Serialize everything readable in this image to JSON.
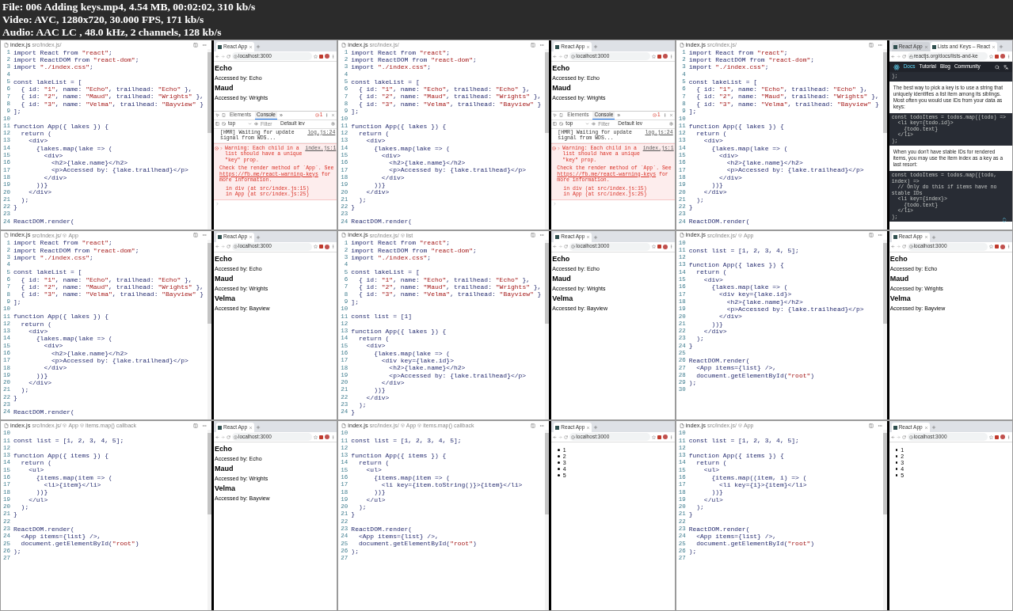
{
  "header": [
    "File: 006 Adding keys.mp4, 4.54 MB, 00:02:02, 310 kb/s",
    "Video: AVC, 1280x720, 30.000 FPS, 171 kb/s",
    "Audio: AAC LC , 48.0 kHz, 2 channels, 128 kb/s"
  ],
  "frames": [
    {
      "editor": {
        "file": "index.js",
        "breadcrumb": [
          "src/index.js/"
        ],
        "lines": [
          {
            "n": "1",
            "code": "import React from \"react\";"
          },
          {
            "n": "2",
            "code": "import ReactDOM from \"react-dom\";"
          },
          {
            "n": "3",
            "code": "import \"./index.css\";"
          },
          {
            "n": "4"
          },
          {
            "n": "5",
            "code": "const lakeList = ["
          },
          {
            "n": "6",
            "code": "  { id: \"1\", name: \"Echo\", trailhead: \"Echo\" },"
          },
          {
            "n": "7",
            "code": "  { id: \"2\", name: \"Maud\", trailhead: \"Wrights\" },"
          },
          {
            "n": "8",
            "code": "  { id: \"3\", name: \"Velma\", trailhead: \"Bayview\" }"
          },
          {
            "n": "9",
            "code": "];"
          },
          {
            "n": "10"
          },
          {
            "n": "11",
            "code": "function App({ lakes }) {"
          },
          {
            "n": "12",
            "code": "  return ("
          },
          {
            "n": "13",
            "code": "    <div>"
          },
          {
            "n": "14",
            "code": "      {lakes.map(lake => ("
          },
          {
            "n": "15",
            "code": "        <div>"
          },
          {
            "n": "16",
            "code": "          <h2>{lake.name}</h2>"
          },
          {
            "n": "17",
            "code": "          <p>Accessed by: {lake.trailhead}</p>"
          },
          {
            "n": "18",
            "code": "        </div>"
          },
          {
            "n": "19",
            "code": "      ))}"
          },
          {
            "n": "20",
            "code": "    </div>"
          },
          {
            "n": "21",
            "code": "  );"
          },
          {
            "n": "22",
            "code": "}"
          },
          {
            "n": "23"
          },
          {
            "n": "24",
            "code": "ReactDOM.render("
          }
        ]
      },
      "browser": {
        "tabs": [
          {
            "title": "React App",
            "selected": true
          }
        ],
        "url": "localhost:3000",
        "secure": false,
        "page": {
          "kind": "lakes",
          "items": [
            {
              "kind": "heading",
              "text": "Echo"
            },
            {
              "kind": "para",
              "text": "Accessed by: Echo"
            },
            {
              "kind": "heading",
              "text": "Maud"
            },
            {
              "kind": "para",
              "text": "Accessed by: Wrights"
            }
          ]
        },
        "devtools": {
          "tabs": [
            {
              "label": "Elements",
              "selected": false
            },
            {
              "label": "Console",
              "selected": true
            }
          ],
          "more": "»",
          "errors": "1",
          "context": "top",
          "filter_placeholder": "Filter",
          "levels": "Default lev",
          "messages": [
            {
              "kind": "log",
              "text": "[HMR] Waiting for update signal from WDS...",
              "source": "log.js:24"
            },
            {
              "kind": "warning",
              "summary": "Warning: Each child in a list should have a unique \"key\" prop.",
              "source": "index.js:1",
              "detail_before": "Check the render method of `App`. See ",
              "link": "https://fb.me/react-warning-keys",
              "detail_after": " for more information.",
              "stack": [
                "in div (at src/index.js:15)",
                "in App (at src/index.js:25)"
              ]
            }
          ]
        }
      }
    },
    {
      "editor": {
        "file": "index.js",
        "breadcrumb": [
          "src/index.js/"
        ],
        "lines": [
          {
            "n": "1",
            "code": "import React from \"react\";"
          },
          {
            "n": "2",
            "code": "import ReactDOM from \"react-dom\";"
          },
          {
            "n": "3",
            "code": "import \"./index.css\";"
          },
          {
            "n": "4"
          },
          {
            "n": "5",
            "code": "const lakeList = ["
          },
          {
            "n": "6",
            "code": "  { id: \"1\", name: \"Echo\", trailhead: \"Echo\" },"
          },
          {
            "n": "7",
            "code": "  { id: \"2\", name: \"Maud\", trailhead: \"Wrights\" },"
          },
          {
            "n": "8",
            "code": "  { id: \"3\", name: \"Velma\", trailhead: \"Bayview\" }"
          },
          {
            "n": "9",
            "code": "];"
          },
          {
            "n": "10"
          },
          {
            "n": "11",
            "code": "function App({ lakes }) {"
          },
          {
            "n": "12",
            "code": "  return ("
          },
          {
            "n": "13",
            "code": "    <div>"
          },
          {
            "n": "14",
            "code": "      {lakes.map(lake => ("
          },
          {
            "n": "15",
            "code": "        <div>"
          },
          {
            "n": "16",
            "code": "          <h2>{lake.name}</h2>"
          },
          {
            "n": "17",
            "code": "          <p>Accessed by: {lake.trailhead}</p>"
          },
          {
            "n": "18",
            "code": "        </div>"
          },
          {
            "n": "19",
            "code": "      ))}"
          },
          {
            "n": "20",
            "code": "    </div>"
          },
          {
            "n": "21",
            "code": "  );"
          },
          {
            "n": "22",
            "code": "}"
          },
          {
            "n": "23"
          },
          {
            "n": "24",
            "code": "ReactDOM.render("
          }
        ]
      },
      "browser": {
        "tabs": [
          {
            "title": "React App",
            "selected": true
          }
        ],
        "url": "localhost:3000",
        "secure": false,
        "page": {
          "kind": "lakes",
          "items": [
            {
              "kind": "heading",
              "text": "Echo"
            },
            {
              "kind": "para",
              "text": "Accessed by: Echo"
            },
            {
              "kind": "heading",
              "text": "Maud"
            },
            {
              "kind": "para",
              "text": "Accessed by: Wrights"
            }
          ]
        },
        "devtools": {
          "tabs": [
            {
              "label": "Elements",
              "selected": false
            },
            {
              "label": "Console",
              "selected": true
            }
          ],
          "more": "»",
          "errors": "1",
          "context": "top",
          "filter_placeholder": "Filter",
          "levels": "Default lev",
          "messages": [
            {
              "kind": "log",
              "text": "[HMR] Waiting for update signal from WDS...",
              "source": "log.js:24"
            },
            {
              "kind": "warning",
              "summary": "Warning: Each child in a list should have a unique \"key\" prop.",
              "source": "index.js:1",
              "detail_before": "Check the render method of `App`. See ",
              "link": "https://fb.me/react-warning-keys",
              "detail_after": " for more information.",
              "stack": [
                "in div (at src/index.js:15)",
                "in App (at src/index.js:25)"
              ]
            }
          ]
        }
      }
    },
    {
      "editor": {
        "file": "index.js",
        "breadcrumb": [
          "src/index.js/"
        ],
        "lines": [
          {
            "n": "1",
            "code": "import React from \"react\";"
          },
          {
            "n": "2",
            "code": "import ReactDOM from \"react-dom\";"
          },
          {
            "n": "3",
            "code": "import \"./index.css\";"
          },
          {
            "n": "4"
          },
          {
            "n": "5",
            "code": "const lakeList = ["
          },
          {
            "n": "6",
            "code": "  { id: \"1\", name: \"Echo\", trailhead: \"Echo\" },"
          },
          {
            "n": "7",
            "code": "  { id: \"2\", name: \"Maud\", trailhead: \"Wrights\" },"
          },
          {
            "n": "8",
            "code": "  { id: \"3\", name: \"Velma\", trailhead: \"Bayview\" }"
          },
          {
            "n": "9",
            "code": "];"
          },
          {
            "n": "10"
          },
          {
            "n": "11",
            "code": "function App({ lakes }) {"
          },
          {
            "n": "12",
            "code": "  return ("
          },
          {
            "n": "13",
            "code": "    <div>"
          },
          {
            "n": "14",
            "code": "      {lakes.map(lake => ("
          },
          {
            "n": "15",
            "code": "        <div>"
          },
          {
            "n": "16",
            "code": "          <h2>{lake.name}</h2>"
          },
          {
            "n": "17",
            "code": "          <p>Accessed by: {lake.trailhead}</p>"
          },
          {
            "n": "18",
            "code": "        </div>"
          },
          {
            "n": "19",
            "code": "      ))}"
          },
          {
            "n": "20",
            "code": "    </div>"
          },
          {
            "n": "21",
            "code": "  );"
          },
          {
            "n": "22",
            "code": "}"
          },
          {
            "n": "23"
          },
          {
            "n": "24",
            "code": "ReactDOM.render("
          }
        ]
      },
      "browser": {
        "tabs": [
          {
            "title": "React App",
            "selected": false
          },
          {
            "title": "Lists and Keys – React",
            "selected": true
          }
        ],
        "url": "reactjs.org/docs/lists-and-ke",
        "secure": true,
        "page": {
          "kind": "docs",
          "nav": [
            {
              "label": "Docs",
              "selected": true
            },
            {
              "label": "Tutorial",
              "selected": false
            },
            {
              "label": "Blog",
              "selected": false
            },
            {
              "label": "Community",
              "selected": false
            }
          ],
          "blocks": [
            {
              "kind": "code",
              "lines": [
                ");"
              ]
            },
            {
              "kind": "text",
              "text": "The best way to pick a key is to use a string that uniquely identifies a list item among its siblings. Most often you would use IDs from your data as keys:"
            },
            {
              "kind": "code",
              "lines": [
                "const todoItems = todos.map((todo) =>",
                "  <li key={todo.id}>",
                "    {todo.text}",
                "  </li>",
                ");"
              ]
            },
            {
              "kind": "text",
              "text": "When you don't have stable IDs for rendered items, you may use the item index as a key as a last resort:"
            },
            {
              "kind": "code",
              "lines": [
                "const todoItems = todos.map((todo, index) =>",
                "  // Only do this if items have no stable IDs",
                "  <li key={index}>",
                "    {todo.text}",
                "  </li>",
                ");"
              ]
            }
          ]
        }
      }
    },
    {
      "editor": {
        "file": "index.js",
        "breadcrumb": [
          "src/index.js/",
          "App"
        ],
        "lines": [
          {
            "n": "1",
            "code": "import React from \"react\";"
          },
          {
            "n": "2",
            "code": "import ReactDOM from \"react-dom\";"
          },
          {
            "n": "3",
            "code": "import \"./index.css\";"
          },
          {
            "n": "4"
          },
          {
            "n": "5",
            "code": "const lakeList = ["
          },
          {
            "n": "6",
            "code": "  { id: \"1\", name: \"Echo\", trailhead: \"Echo\" },"
          },
          {
            "n": "7",
            "code": "  { id: \"2\", name: \"Maud\", trailhead: \"Wrights\" },"
          },
          {
            "n": "8",
            "code": "  { id: \"3\", name: \"Velma\", trailhead: \"Bayview\" }"
          },
          {
            "n": "9",
            "code": "];"
          },
          {
            "n": "10"
          },
          {
            "n": "11",
            "code": "function App({ lakes }) {"
          },
          {
            "n": "12",
            "code": "  return ("
          },
          {
            "n": "13",
            "code": "    <div>"
          },
          {
            "n": "14",
            "code": "      {lakes.map(lake => ("
          },
          {
            "n": "15",
            "code": "        <div>"
          },
          {
            "n": "16",
            "code": "          <h2>{lake.name}</h2>"
          },
          {
            "n": "17",
            "code": "          <p>Accessed by: {lake.trailhead}</p>"
          },
          {
            "n": "18",
            "code": "        </div>"
          },
          {
            "n": "19",
            "code": "      ))}"
          },
          {
            "n": "20",
            "code": "    </div>"
          },
          {
            "n": "21",
            "code": "  );"
          },
          {
            "n": "22",
            "code": "}"
          },
          {
            "n": "23"
          },
          {
            "n": "24",
            "code": "ReactDOM.render("
          }
        ]
      },
      "browser": {
        "tabs": [
          {
            "title": "React App",
            "selected": true
          }
        ],
        "url": "localhost:3000",
        "secure": false,
        "page": {
          "kind": "lakes",
          "items": [
            {
              "kind": "heading",
              "text": "Echo"
            },
            {
              "kind": "para",
              "text": "Accessed by: Echo"
            },
            {
              "kind": "heading",
              "text": "Maud"
            },
            {
              "kind": "para",
              "text": "Accessed by: Wrights"
            },
            {
              "kind": "heading",
              "text": "Velma"
            },
            {
              "kind": "para",
              "text": "Accessed by: Bayview"
            }
          ]
        }
      }
    },
    {
      "editor": {
        "file": "index.js",
        "breadcrumb": [
          "src/index.js/",
          "list"
        ],
        "lines": [
          {
            "n": "1",
            "code": "import React from \"react\";"
          },
          {
            "n": "2",
            "code": "import ReactDOM from \"react-dom\";"
          },
          {
            "n": "3",
            "code": "import \"./index.css\";"
          },
          {
            "n": "4"
          },
          {
            "n": "5",
            "code": "const lakeList = ["
          },
          {
            "n": "6",
            "code": "  { id: \"1\", name: \"Echo\", trailhead: \"Echo\" },"
          },
          {
            "n": "7",
            "code": "  { id: \"2\", name: \"Maud\", trailhead: \"Wrights\" },"
          },
          {
            "n": "8",
            "code": "  { id: \"3\", name: \"Velma\", trailhead: \"Bayview\" }"
          },
          {
            "n": "9",
            "code": "];"
          },
          {
            "n": "10"
          },
          {
            "n": "11",
            "code": "const list = [1]"
          },
          {
            "n": "12"
          },
          {
            "n": "13",
            "code": "function App({ lakes }) {"
          },
          {
            "n": "14",
            "code": "  return ("
          },
          {
            "n": "15",
            "code": "    <div>"
          },
          {
            "n": "16",
            "code": "      {lakes.map(lake => ("
          },
          {
            "n": "17",
            "code": "        <div key={lake.id}>"
          },
          {
            "n": "18",
            "code": "          <h2>{lake.name}</h2>"
          },
          {
            "n": "19",
            "code": "          <p>Accessed by: {lake.trailhead}</p>"
          },
          {
            "n": "20",
            "code": "        </div>"
          },
          {
            "n": "21",
            "code": "      ))}"
          },
          {
            "n": "22",
            "code": "    </div>"
          },
          {
            "n": "23",
            "code": "  );"
          },
          {
            "n": "24",
            "code": "}"
          }
        ]
      },
      "browser": {
        "tabs": [
          {
            "title": "React App",
            "selected": true
          }
        ],
        "url": "localhost:3000",
        "secure": false,
        "page": {
          "kind": "lakes",
          "items": [
            {
              "kind": "heading",
              "text": "Echo"
            },
            {
              "kind": "para",
              "text": "Accessed by: Echo"
            },
            {
              "kind": "heading",
              "text": "Maud"
            },
            {
              "kind": "para",
              "text": "Accessed by: Wrights"
            },
            {
              "kind": "heading",
              "text": "Velma"
            },
            {
              "kind": "para",
              "text": "Accessed by: Bayview"
            }
          ]
        }
      }
    },
    {
      "editor": {
        "file": "index.js",
        "breadcrumb": [
          "src/index.js/",
          "App"
        ],
        "lines": [
          {
            "n": "10"
          },
          {
            "n": "11",
            "code": "const list = [1, 2, 3, 4, 5];"
          },
          {
            "n": "12"
          },
          {
            "n": "13",
            "code": "function App({ lakes }) {"
          },
          {
            "n": "14",
            "code": "  return ("
          },
          {
            "n": "15",
            "code": "    <div>"
          },
          {
            "n": "16",
            "code": "      {lakes.map(lake => ("
          },
          {
            "n": "17",
            "code": "        <div key={lake.id}>"
          },
          {
            "n": "18",
            "code": "          <h2>{lake.name}</h2>"
          },
          {
            "n": "19",
            "code": "          <p>Accessed by: {lake.trailhead}</p>"
          },
          {
            "n": "20",
            "code": "        </div>"
          },
          {
            "n": "21",
            "code": "      ))}"
          },
          {
            "n": "22",
            "code": "    </div>"
          },
          {
            "n": "23",
            "code": "  );"
          },
          {
            "n": "24",
            "code": "}"
          },
          {
            "n": "25"
          },
          {
            "n": "26",
            "code": "ReactDOM.render("
          },
          {
            "n": "27",
            "code": "  <App items={list} />,"
          },
          {
            "n": "28",
            "code": "  document.getElementById(\"root\")"
          },
          {
            "n": "29",
            "code": ");"
          },
          {
            "n": "30"
          }
        ]
      },
      "browser": {
        "tabs": [
          {
            "title": "React App",
            "selected": true
          }
        ],
        "url": "localhost:3000",
        "secure": false,
        "page": {
          "kind": "lakes",
          "items": [
            {
              "kind": "heading",
              "text": "Echo"
            },
            {
              "kind": "para",
              "text": "Accessed by: Echo"
            },
            {
              "kind": "heading",
              "text": "Maud"
            },
            {
              "kind": "para",
              "text": "Accessed by: Wrights"
            },
            {
              "kind": "heading",
              "text": "Velma"
            },
            {
              "kind": "para",
              "text": "Accessed by: Bayview"
            }
          ]
        }
      }
    },
    {
      "editor": {
        "file": "index.js",
        "breadcrumb": [
          "src/index.js/",
          "App",
          "items.map() callback"
        ],
        "lines": [
          {
            "n": "10"
          },
          {
            "n": "11",
            "code": "const list = [1, 2, 3, 4, 5];"
          },
          {
            "n": "12"
          },
          {
            "n": "13",
            "code": "function App({ items }) {"
          },
          {
            "n": "14",
            "code": "  return ("
          },
          {
            "n": "15",
            "code": "    <ul>"
          },
          {
            "n": "16",
            "code": "      {items.map(item => ("
          },
          {
            "n": "17",
            "code": "        <li>{item}</li>"
          },
          {
            "n": "18",
            "code": "      ))}"
          },
          {
            "n": "19",
            "code": "    </ul>"
          },
          {
            "n": "20",
            "code": "  );"
          },
          {
            "n": "21",
            "code": "}"
          },
          {
            "n": "22"
          },
          {
            "n": "23",
            "code": "ReactDOM.render("
          },
          {
            "n": "24",
            "code": "  <App items={list} />,"
          },
          {
            "n": "25",
            "code": "  document.getElementById(\"root\")"
          },
          {
            "n": "26",
            "code": ");"
          },
          {
            "n": "27"
          }
        ]
      },
      "browser": {
        "tabs": [
          {
            "title": "React App",
            "selected": true
          }
        ],
        "url": "localhost:3000",
        "secure": false,
        "page": {
          "kind": "lakes",
          "items": [
            {
              "kind": "heading",
              "text": "Echo"
            },
            {
              "kind": "para",
              "text": "Accessed by: Echo"
            },
            {
              "kind": "heading",
              "text": "Maud"
            },
            {
              "kind": "para",
              "text": "Accessed by: Wrights"
            },
            {
              "kind": "heading",
              "text": "Velma"
            },
            {
              "kind": "para",
              "text": "Accessed by: Bayview"
            }
          ]
        }
      }
    },
    {
      "editor": {
        "file": "index.js",
        "breadcrumb": [
          "src/index.js/",
          "App",
          "items.map() callback"
        ],
        "lines": [
          {
            "n": "10"
          },
          {
            "n": "11",
            "code": "const list = [1, 2, 3, 4, 5];"
          },
          {
            "n": "12"
          },
          {
            "n": "13",
            "code": "function App({ items }) {"
          },
          {
            "n": "14",
            "code": "  return ("
          },
          {
            "n": "15",
            "code": "    <ul>"
          },
          {
            "n": "16",
            "code": "      {items.map(item => ("
          },
          {
            "n": "17",
            "code": "        <li key={item.toString()}>{item}</li>"
          },
          {
            "n": "18",
            "code": "      ))}"
          },
          {
            "n": "19",
            "code": "    </ul>"
          },
          {
            "n": "20",
            "code": "  );"
          },
          {
            "n": "21",
            "code": "}"
          },
          {
            "n": "22"
          },
          {
            "n": "23",
            "code": "ReactDOM.render("
          },
          {
            "n": "24",
            "code": "  <App items={list} />,"
          },
          {
            "n": "25",
            "code": "  document.getElementById(\"root\")"
          },
          {
            "n": "26",
            "code": ");"
          },
          {
            "n": "27"
          }
        ]
      },
      "browser": {
        "tabs": [
          {
            "title": "React App",
            "selected": true
          }
        ],
        "url": "localhost:3000",
        "secure": false,
        "page": {
          "kind": "list",
          "items": [
            "1",
            "2",
            "3",
            "4",
            "5"
          ]
        }
      }
    },
    {
      "editor": {
        "file": "index.js",
        "breadcrumb": [
          "src/index.js/",
          "App"
        ],
        "lines": [
          {
            "n": "10"
          },
          {
            "n": "11",
            "code": "const list = [1, 2, 3, 4, 5];"
          },
          {
            "n": "12"
          },
          {
            "n": "13",
            "code": "function App({ items }) {"
          },
          {
            "n": "14",
            "code": "  return ("
          },
          {
            "n": "15",
            "code": "    <ul>"
          },
          {
            "n": "16",
            "code": "      {items.map((item, i) => ("
          },
          {
            "n": "17",
            "code": "        <li key={i}>{item}</li>"
          },
          {
            "n": "18",
            "code": "      ))}"
          },
          {
            "n": "19",
            "code": "    </ul>"
          },
          {
            "n": "20",
            "code": "  );"
          },
          {
            "n": "21",
            "code": "}"
          },
          {
            "n": "22"
          },
          {
            "n": "23",
            "code": "ReactDOM.render("
          },
          {
            "n": "24",
            "code": "  <App items={list} />,"
          },
          {
            "n": "25",
            "code": "  document.getElementById(\"root\")"
          },
          {
            "n": "26",
            "code": ");"
          },
          {
            "n": "27"
          }
        ]
      },
      "browser": {
        "tabs": [
          {
            "title": "React App",
            "selected": true
          }
        ],
        "url": "localhost:3000",
        "secure": false,
        "page": {
          "kind": "list",
          "items": [
            "1",
            "2",
            "3",
            "4",
            "5"
          ]
        }
      }
    }
  ]
}
